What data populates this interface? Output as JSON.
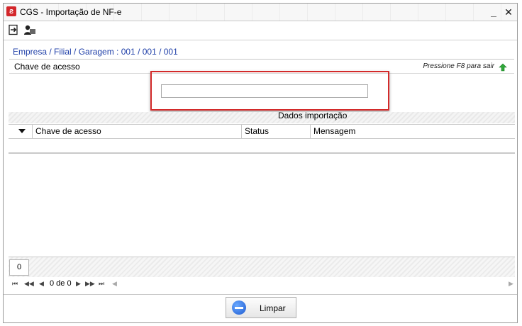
{
  "window": {
    "title": "CGS - Importação de NF-e",
    "app_icon": "cgs-logo",
    "minimize_label": "_",
    "close_label": "✕"
  },
  "toolbar": {
    "buttons": [
      {
        "icon": "exit-door-icon"
      },
      {
        "icon": "user-card-icon"
      }
    ]
  },
  "breadcrumb": "Empresa / Filial / Garagem : 001 / 001 / 001",
  "access_key": {
    "label": "Chave de acesso",
    "hint": "Pressione F8 para sair",
    "hint_icon": "green-up-arrow-icon",
    "value": ""
  },
  "import_data": {
    "title": "Dados importação",
    "columns": [
      "Chave de acesso",
      "Status",
      "Mensagem"
    ],
    "rows": []
  },
  "footer": {
    "count": "0",
    "record_nav": "0 de 0",
    "nav_first": "⏮",
    "nav_prev_page": "◀◀",
    "nav_prev": "◀",
    "nav_next": "▶",
    "nav_next_page": "▶▶",
    "nav_last": "⏭"
  },
  "actions": {
    "clear_label": "Limpar"
  },
  "colors": {
    "accent_red": "#d32a2a",
    "breadcrumb_blue": "#1f3fa8",
    "icon_green": "#2fa83a"
  }
}
